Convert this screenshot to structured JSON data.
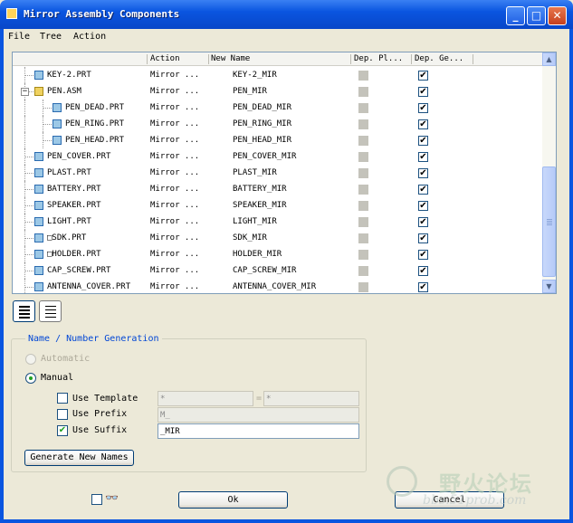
{
  "window": {
    "title": "Mirror Assembly Components",
    "minimize": "_",
    "maximize": "□",
    "close": "✕"
  },
  "menu": {
    "file": "File",
    "tree": "Tree",
    "action": "Action"
  },
  "columns": {
    "action": "Action",
    "new_name": "New Name",
    "dep_placement": "Dep. Pl...",
    "dep_geometry": "Dep. Ge..."
  },
  "rows": [
    {
      "name": "KEY-2.PRT",
      "action": "Mirror ...",
      "new_name": "KEY-2_MIR",
      "dep_pl": false,
      "dep_ge": true,
      "level": 1,
      "type": "part"
    },
    {
      "name": "PEN.ASM",
      "action": "Mirror ...",
      "new_name": "PEN_MIR",
      "dep_pl": false,
      "dep_ge": true,
      "level": 1,
      "type": "assembly",
      "expander": "−"
    },
    {
      "name": "PEN_DEAD.PRT",
      "action": "Mirror ...",
      "new_name": "PEN_DEAD_MIR",
      "dep_pl": false,
      "dep_ge": true,
      "level": 2,
      "type": "part"
    },
    {
      "name": "PEN_RING.PRT",
      "action": "Mirror ...",
      "new_name": "PEN_RING_MIR",
      "dep_pl": false,
      "dep_ge": true,
      "level": 2,
      "type": "part"
    },
    {
      "name": "PEN_HEAD.PRT",
      "action": "Mirror ...",
      "new_name": "PEN_HEAD_MIR",
      "dep_pl": false,
      "dep_ge": true,
      "level": 2,
      "type": "part"
    },
    {
      "name": "PEN_COVER.PRT",
      "action": "Mirror ...",
      "new_name": "PEN_COVER_MIR",
      "dep_pl": false,
      "dep_ge": true,
      "level": 1,
      "type": "part"
    },
    {
      "name": "PLAST.PRT",
      "action": "Mirror ...",
      "new_name": "PLAST_MIR",
      "dep_pl": false,
      "dep_ge": true,
      "level": 1,
      "type": "part"
    },
    {
      "name": "BATTERY.PRT",
      "action": "Mirror ...",
      "new_name": "BATTERY_MIR",
      "dep_pl": false,
      "dep_ge": true,
      "level": 1,
      "type": "part"
    },
    {
      "name": "SPEAKER.PRT",
      "action": "Mirror ...",
      "new_name": "SPEAKER_MIR",
      "dep_pl": false,
      "dep_ge": true,
      "level": 1,
      "type": "part"
    },
    {
      "name": "LIGHT.PRT",
      "action": "Mirror ...",
      "new_name": "LIGHT_MIR",
      "dep_pl": false,
      "dep_ge": true,
      "level": 1,
      "type": "part"
    },
    {
      "name": "□SDK.PRT",
      "action": "Mirror ...",
      "new_name": "SDK_MIR",
      "dep_pl": false,
      "dep_ge": true,
      "level": 1,
      "type": "part"
    },
    {
      "name": "□HOLDER.PRT",
      "action": "Mirror ...",
      "new_name": "HOLDER_MIR",
      "dep_pl": false,
      "dep_ge": true,
      "level": 1,
      "type": "part"
    },
    {
      "name": "CAP_SCREW.PRT",
      "action": "Mirror ...",
      "new_name": "CAP_SCREW_MIR",
      "dep_pl": false,
      "dep_ge": true,
      "level": 1,
      "type": "part"
    },
    {
      "name": "ANTENNA_COVER.PRT",
      "action": "Mirror ...",
      "new_name": "ANTENNA_COVER_MIR",
      "dep_pl": false,
      "dep_ge": true,
      "level": 1,
      "type": "part"
    }
  ],
  "name_gen": {
    "group_label": "Name / Number Generation",
    "automatic": "Automatic",
    "manual": "Manual",
    "use_template": "Use Template",
    "use_prefix": "Use Prefix",
    "use_suffix": "Use Suffix",
    "template_value": "*",
    "template_sep": "=",
    "template_value2": "*",
    "prefix_value": "M_",
    "suffix_value": "_MIR",
    "use_template_checked": false,
    "use_prefix_checked": false,
    "use_suffix_checked": true,
    "generate_button": "Generate New Names"
  },
  "footer": {
    "glasses_icon": "👓",
    "ok": "Ok",
    "cancel": "Cancel"
  },
  "watermark": {
    "text": "野火论坛",
    "url": "bbs.51prob.com"
  },
  "icons": [
    "app-icon",
    "part-icon",
    "assembly-icon",
    "list-view-icon",
    "detail-view-icon",
    "glasses-icon"
  ]
}
